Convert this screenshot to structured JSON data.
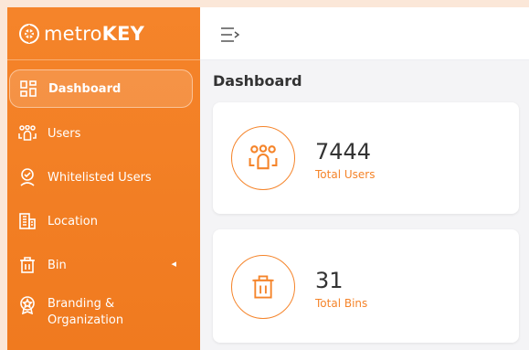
{
  "brand": {
    "name_light": "metro",
    "name_bold": "KEY"
  },
  "sidebar": {
    "items": [
      {
        "label": "Dashboard",
        "icon": "dashboard-grid-icon",
        "active": true
      },
      {
        "label": "Users",
        "icon": "users-icon"
      },
      {
        "label": "Whitelisted Users",
        "icon": "user-check-icon"
      },
      {
        "label": "Location",
        "icon": "building-icon"
      },
      {
        "label": "Bin",
        "icon": "trash-icon",
        "caret": "◂"
      },
      {
        "label_line1": "Branding &",
        "label_line2": "Organization",
        "icon": "badge-icon"
      }
    ]
  },
  "header": {
    "toggle_icon": "menu-toggle-icon"
  },
  "main": {
    "title": "Dashboard",
    "cards": [
      {
        "value": "7444",
        "label": "Total Users",
        "icon": "users-icon"
      },
      {
        "value": "31",
        "label": "Total Bins",
        "icon": "trash-icon"
      }
    ]
  },
  "colors": {
    "accent": "#f5842a",
    "background": "#f4f4f6",
    "frame": "#fbe7d8"
  }
}
